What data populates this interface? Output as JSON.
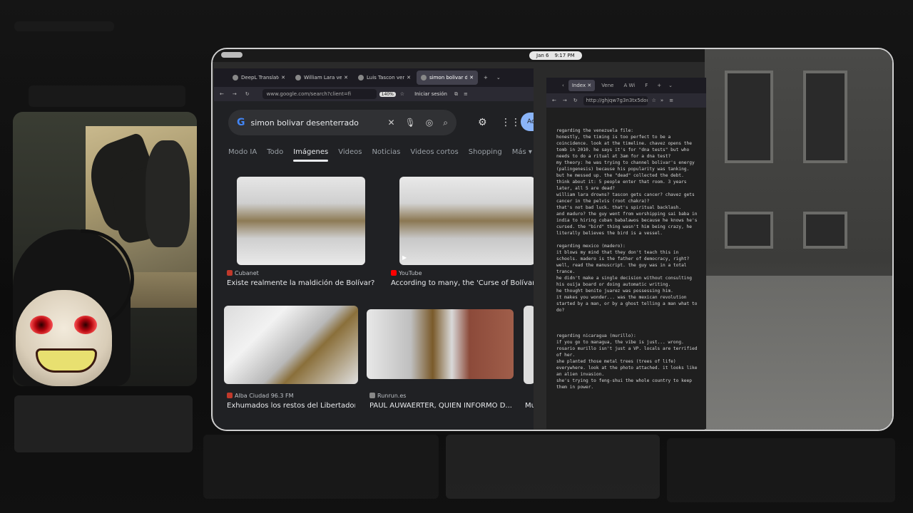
{
  "clock": {
    "date": "Jan 6",
    "time": "9:17 PM"
  },
  "browser_left": {
    "tabs": [
      {
        "label": "DeepL Translate - E",
        "icon": "deepl-icon"
      },
      {
        "label": "William Lara venez",
        "icon": "google-icon"
      },
      {
        "label": "Luis Tascon venezu",
        "icon": "google-icon"
      },
      {
        "label": "simon bolivar dese",
        "icon": "google-icon"
      }
    ],
    "url": "www.google.com/search?client=fi",
    "zoom": "140%",
    "signin": "Iniciar sesión"
  },
  "google": {
    "query": "simon bolivar desenterrado",
    "signin_button": "Ac",
    "tabs": [
      "Modo IA",
      "Todo",
      "Imágenes",
      "Videos",
      "Noticias",
      "Videos cortos",
      "Shopping",
      "Más ▾"
    ],
    "active_tab": "Imágenes",
    "results": [
      {
        "source": "Cubanet",
        "caption": "Existe realmente la maldición de Bolívar?",
        "color": "#c0392b"
      },
      {
        "source": "YouTube",
        "caption": "According to many, the 'Curse of Bolívar' app",
        "color": "#ff0000"
      },
      {
        "source": "Alba Ciudad 96.3 FM",
        "caption": "Exhumados los restos del Libertador ...",
        "color": "#c0392b"
      },
      {
        "source": "Runrun.es",
        "caption": "PAUL AUWAERTER, QUIEN INFORMO D...",
        "color": "#888888"
      },
      {
        "source": "",
        "caption": "Mu",
        "color": "#4a90d9"
      }
    ]
  },
  "browser_right": {
    "tabs": [
      "Index",
      "Vene",
      "A Wi",
      "F"
    ],
    "url": "http://ghjqw7g3n3tx5dou"
  },
  "notes": "regarding the venezuela file:\nhonestly, the timing is too perfect to be a coincidence. look at the timeline. chavez opens the tomb in 2010. he says it's for \"dna tests\" but who needs to do a ritual at 3am for a dna test?\nmy theory: he was trying to channel bolivar's energy (palingenesis) because his popularity was tanking.\nbut he messed up. the \"dead\" collected the debt.\nthink about it: 5 people enter that room. 3 years later, all 5 are dead?\nwilliam lara drowns? tascon gets cancer? chavez gets cancer in the pelvis (root chakra)?\nthat's not bad luck. that's spiritual backlash.\nand maduro? the guy went from worshipping sai baba in india to hiring cuban babalawos because he knows he's cursed. the \"bird\" thing wasn't him being crazy, he literally believes the bird is a vessel.\n\nregarding mexico (madero):\nit blows my mind that they don't teach this in schools. madero is the father of democracy, right?\nwell, read the manuscript. the guy was in a total trance.\nhe didn't make a single decision without consulting his ouija board or doing automatic writing.\nhe thought benito juarez was possessing him.\nit makes you wonder... was the mexican revolution started by a man, or by a ghost telling a man what to do?\n\n\n\nregarding nicaragua (murillo):\nif you go to managua, the vibe is just... wrong.\nrosario murillo isn't just a VP. locals are terrified of her.\nshe planted those metal trees (trees of life) everywhere. look at the photo attached. it looks like an alien invasion.\nshe's trying to feng-shui the whole country to keep them in power."
}
